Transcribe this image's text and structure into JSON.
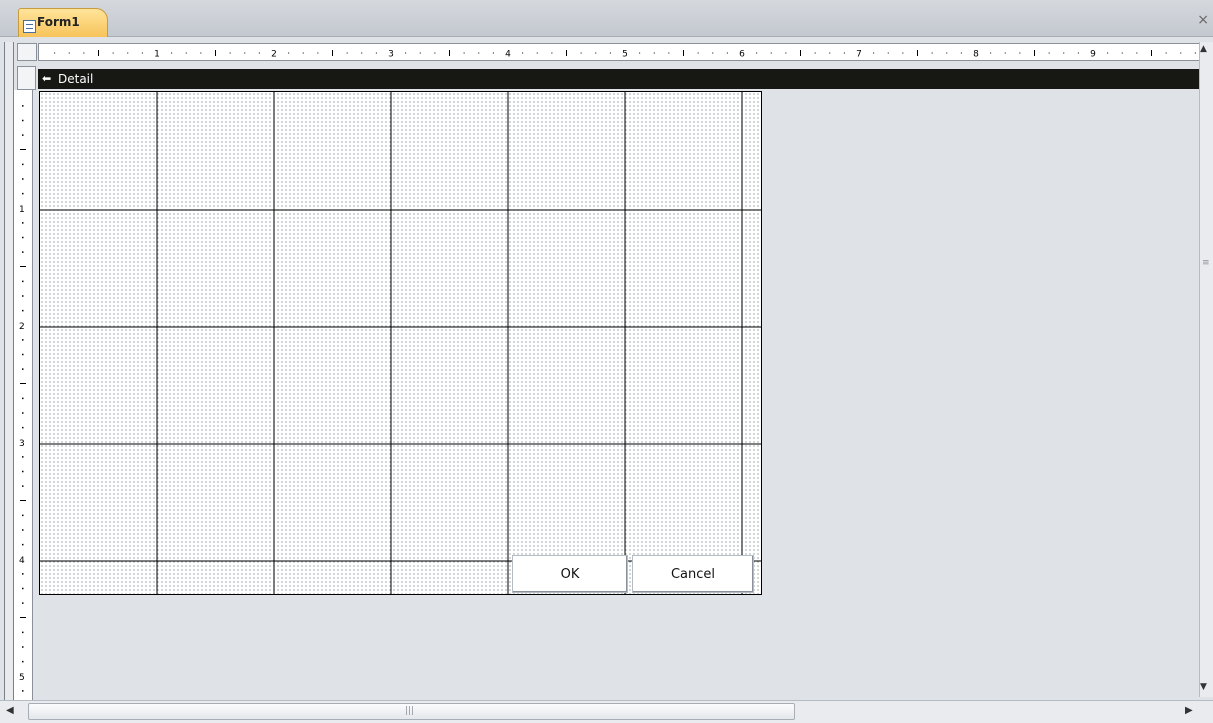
{
  "tab": {
    "label": "Form1",
    "icon": "form-icon"
  },
  "window": {
    "close_glyph": "×"
  },
  "horizontal_ruler": {
    "numbers": [
      "1",
      "2",
      "3",
      "4",
      "5",
      "6",
      "7",
      "8",
      "9"
    ]
  },
  "vertical_ruler": {
    "numbers": [
      "1",
      "2",
      "3",
      "4",
      "5"
    ]
  },
  "section": {
    "label": "Detail",
    "arrow_glyph": "⬅"
  },
  "buttons": {
    "ok": "OK",
    "cancel": "Cancel"
  },
  "scrollbars": {
    "up_glyph": "▲",
    "down_glyph": "▼",
    "left_glyph": "◀",
    "right_glyph": "▶",
    "vertical_grip": "≡",
    "horizontal_grip": "|||"
  }
}
